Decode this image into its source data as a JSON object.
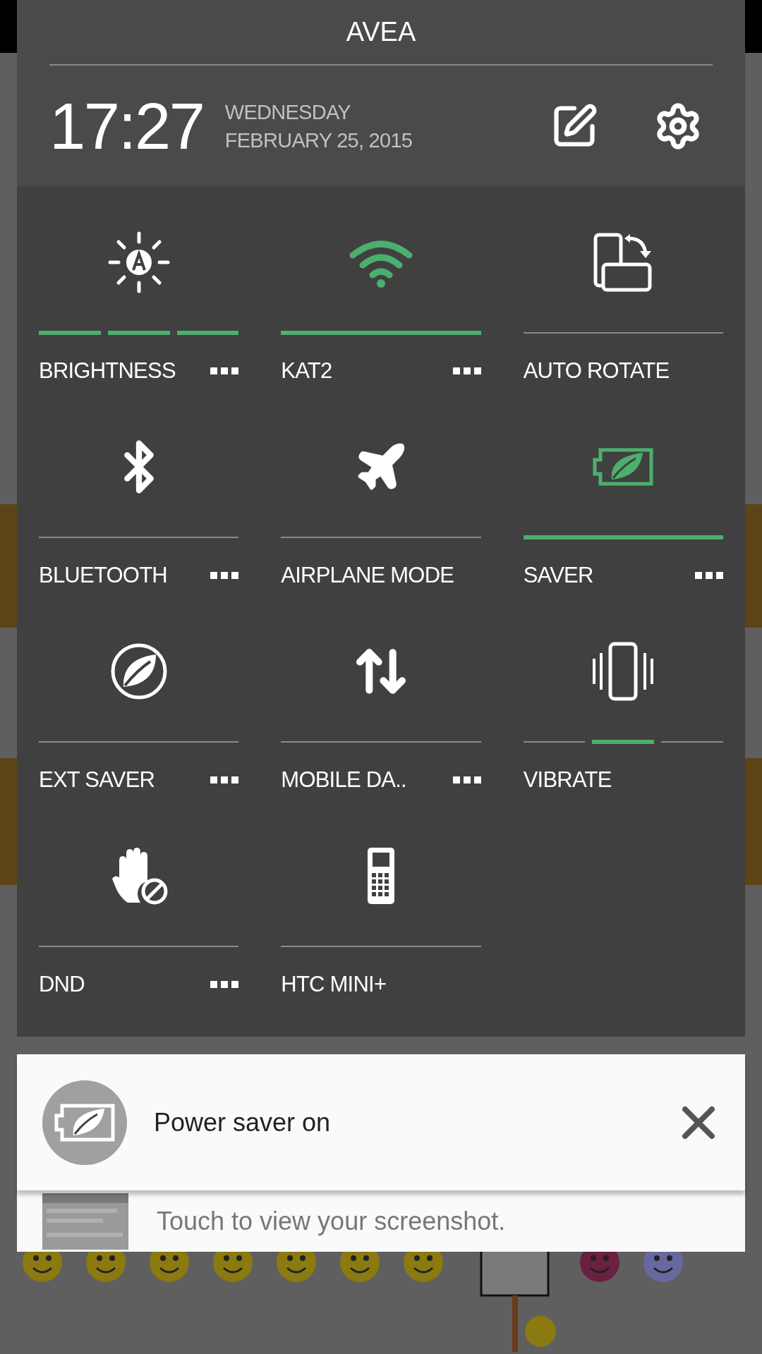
{
  "header": {
    "carrier": "AVEA",
    "time": "17:27",
    "weekday": "WEDNESDAY",
    "date": "FEBRUARY 25, 2015"
  },
  "tiles": [
    {
      "label": "BRIGHTNESS",
      "more": true,
      "segments": [
        {
          "on": true
        },
        {
          "on": true
        },
        {
          "on": true
        }
      ]
    },
    {
      "label": "KAT2",
      "more": true,
      "on": true
    },
    {
      "label": "AUTO ROTATE",
      "more": false,
      "on": false
    },
    {
      "label": "BLUETOOTH",
      "more": true,
      "on": false
    },
    {
      "label": "AIRPLANE MODE",
      "more": false,
      "on": false
    },
    {
      "label": "SAVER",
      "more": true,
      "on": true
    },
    {
      "label": "EXT SAVER",
      "more": true,
      "on": false
    },
    {
      "label": "MOBILE DA..",
      "more": true,
      "on": false
    },
    {
      "label": "VIBRATE",
      "more": false,
      "segments": [
        {
          "on": false
        },
        {
          "on": true
        },
        {
          "on": false
        }
      ]
    },
    {
      "label": "DND",
      "more": true,
      "on": false
    },
    {
      "label": "HTC MINI+",
      "more": false,
      "on": false
    }
  ],
  "notifications": [
    {
      "title": "Power saver on"
    },
    {
      "title": "Touch to view your screenshot."
    }
  ]
}
